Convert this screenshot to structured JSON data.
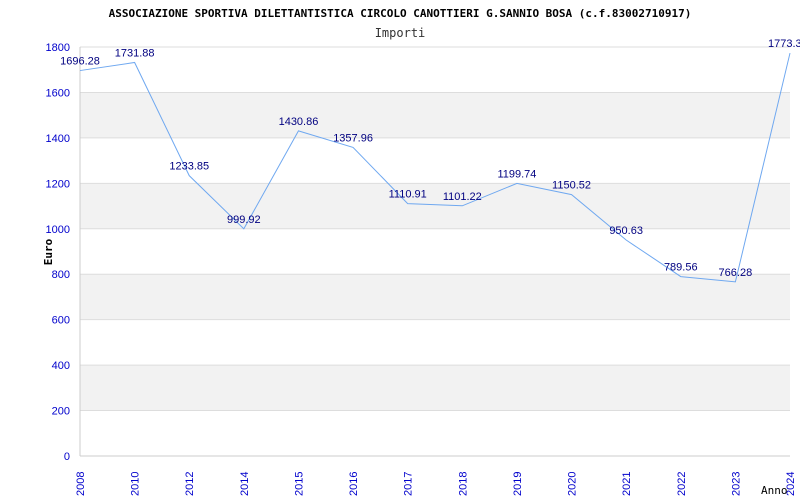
{
  "chart_data": {
    "type": "line",
    "title": "ASSOCIAZIONE SPORTIVA DILETTANTISTICA CIRCOLO CANOTTIERI G.SANNIO BOSA (c.f.83002710917)",
    "subtitle": "Importi",
    "xlabel": "Anno",
    "ylabel": "Euro",
    "ylim": [
      0,
      1800
    ],
    "y_ticks": [
      0,
      200,
      400,
      600,
      800,
      1000,
      1200,
      1400,
      1600,
      1800
    ],
    "grid": "horizontal bands",
    "categories": [
      "2008",
      "2010",
      "2012",
      "2014",
      "2015",
      "2016",
      "2017",
      "2018",
      "2019",
      "2020",
      "2021",
      "2022",
      "2023",
      "2024"
    ],
    "series": [
      {
        "values": [
          1696.28,
          1731.88,
          1233.85,
          999.92,
          1430.86,
          1357.96,
          1110.91,
          1101.22,
          1199.74,
          1150.52,
          950.63,
          789.56,
          766.28,
          1773.3
        ]
      }
    ],
    "data_labels": [
      "1696.28",
      "1731.88",
      "1233.85",
      "999.92",
      "1430.86",
      "1357.96",
      "1110.91",
      "1101.22",
      "1199.74",
      "1150.52",
      "950.63",
      "789.56",
      "766.28",
      "1773.3"
    ],
    "colors": {
      "line": "#6fa8f0",
      "axis_text": "#0000cc",
      "data_label": "#000080",
      "band": "#f2f2f2",
      "gridline": "#dddddd",
      "title": "#000000"
    }
  }
}
